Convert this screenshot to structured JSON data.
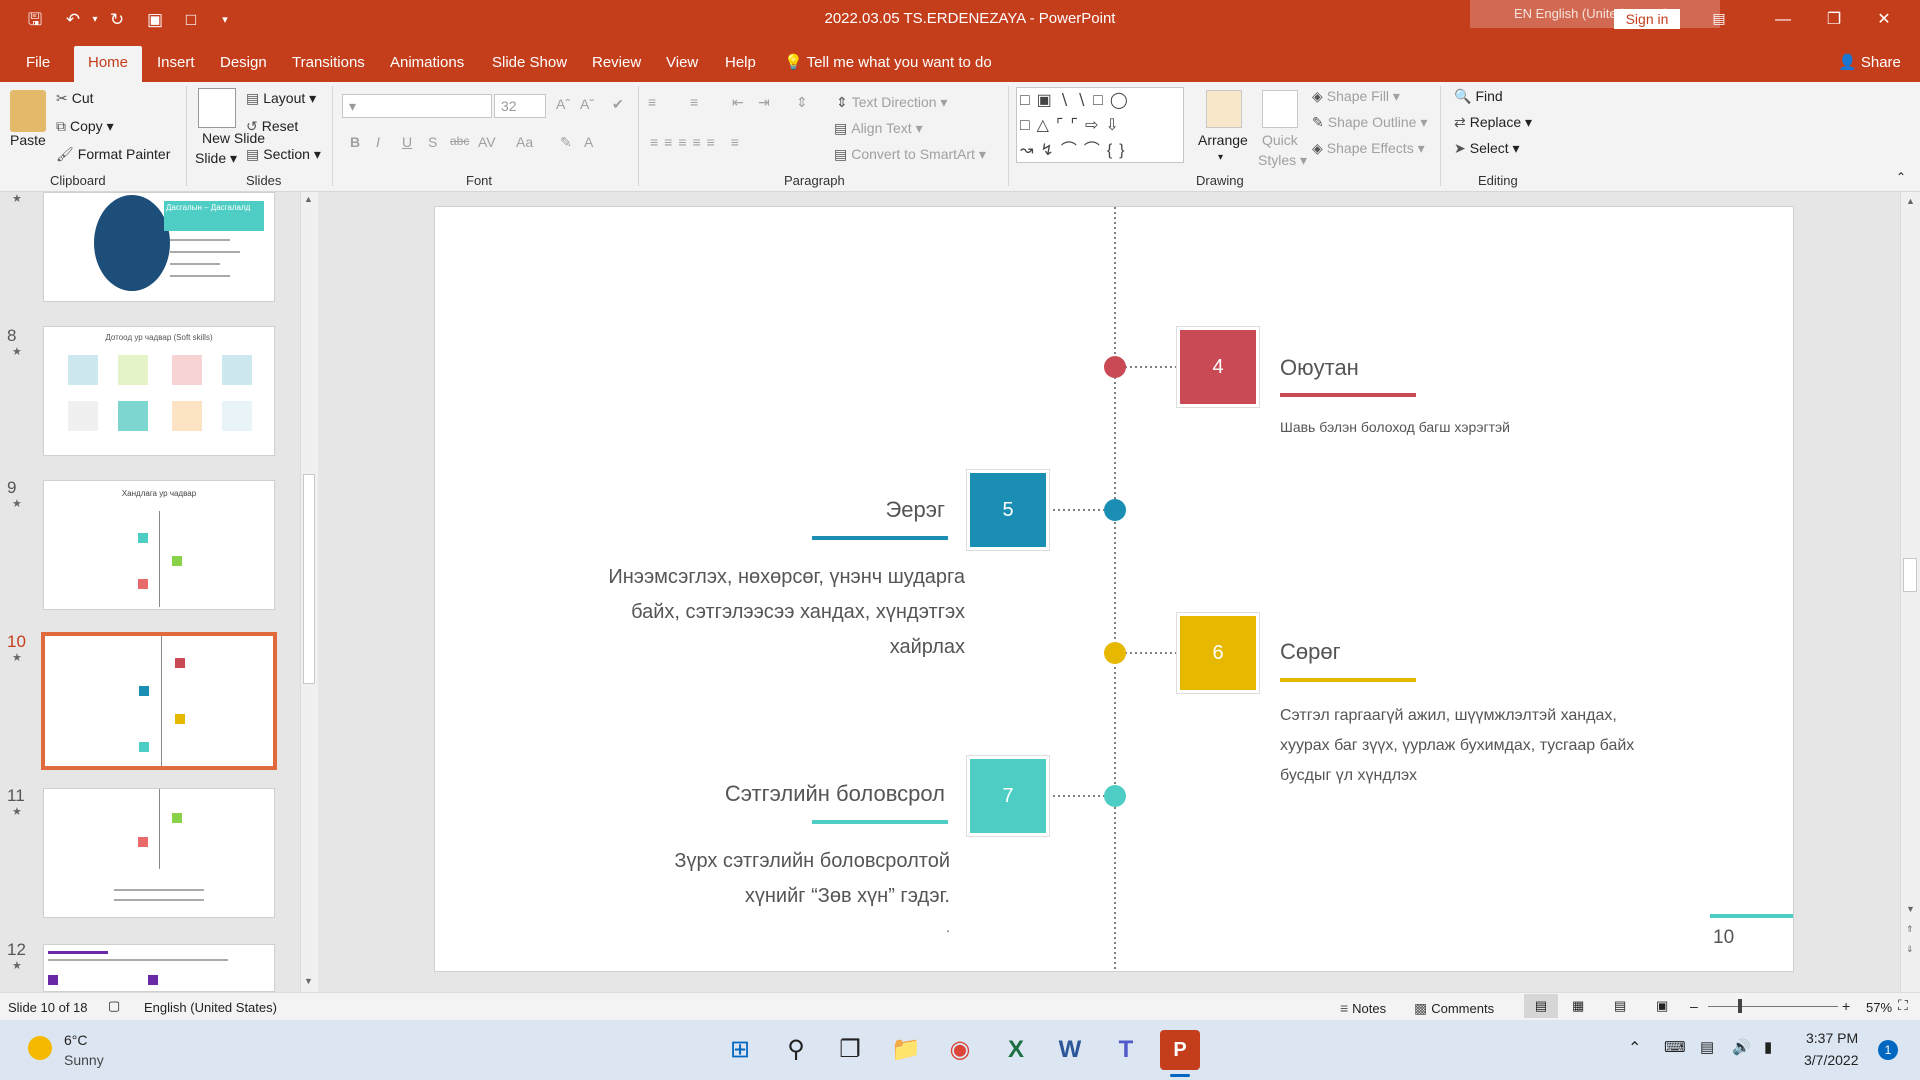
{
  "app": {
    "title": "2022.03.05 TS.ERDENEZAYA  -  PowerPoint",
    "language_indicator": "EN English (United States)",
    "sign_in": "Sign in",
    "accent_color": "#c43e1c"
  },
  "tabs": [
    "File",
    "Home",
    "Insert",
    "Design",
    "Transitions",
    "Animations",
    "Slide Show",
    "Review",
    "View",
    "Help"
  ],
  "tell_me": "Tell me what you want to do",
  "share": "Share",
  "ribbon": {
    "clipboard": {
      "label": "Clipboard",
      "paste": "Paste",
      "cut": "Cut",
      "copy": "Copy",
      "format_painter": "Format Painter"
    },
    "slides": {
      "label": "Slides",
      "new_slide": "New Slide",
      "new_slide_2": "Slide",
      "layout": "Layout",
      "reset": "Reset",
      "section": "Section"
    },
    "font": {
      "label": "Font",
      "size": "32",
      "buttons": [
        "B",
        "I",
        "U",
        "S",
        "abc",
        "AV",
        "Aa"
      ]
    },
    "paragraph": {
      "label": "Paragraph",
      "text_direction": "Text Direction",
      "align_text": "Align Text",
      "smartart": "Convert to SmartArt"
    },
    "drawing": {
      "label": "Drawing",
      "arrange": "Arrange",
      "quick_styles": "Quick",
      "quick_styles_2": "Styles",
      "shape_fill": "Shape Fill",
      "shape_outline": "Shape Outline",
      "shape_effects": "Shape Effects"
    },
    "editing": {
      "label": "Editing",
      "find": "Find",
      "replace": "Replace",
      "select": "Select"
    }
  },
  "thumbnails": [
    {
      "num": "",
      "title": "Дасгалын  – Дасгалалд"
    },
    {
      "num": "8",
      "title": "Дотоод ур чадвар (Soft skills)"
    },
    {
      "num": "9",
      "title": "Хандлага ур чадвар"
    },
    {
      "num": "10",
      "title": ""
    },
    {
      "num": "11",
      "title": ""
    },
    {
      "num": "12",
      "title": ""
    }
  ],
  "slide": {
    "items": [
      {
        "num": "4",
        "title": "Оюутан",
        "text": "Шавь бэлэн болоход багш хэрэгтэй",
        "color": "#c94a55"
      },
      {
        "num": "5",
        "title": "Эерэг",
        "text": [
          "Инээмсэглэх, нөхөрсөг, үнэнч шударга",
          "байх, сэтгэлээсээ хандах, хүндэтгэх",
          "хайрлах"
        ],
        "color": "#1a8fb3"
      },
      {
        "num": "6",
        "title": "Сөрөг",
        "text": [
          "Сэтгэл гаргаагүй ажил, шүүмжлэлтэй хандах,",
          "хуурах баг зүүх,  үурлаж бухимдах, тусгаар байх",
          "бусдыг үл хүндлэх"
        ],
        "color": "#e6b800"
      },
      {
        "num": "7",
        "title": "Сэтгэлийн боловсрол",
        "text": [
          "Зүрх сэтгэлийн боловсролтой",
          "хүнийг “Зөв хүн” гэдэг."
        ],
        "color": "#4ecdc4"
      }
    ],
    "page_number": "10",
    "dot_text": "."
  },
  "status": {
    "slide_of": "Slide 10 of 18",
    "language": "English (United States)",
    "notes": "Notes",
    "comments": "Comments",
    "zoom": "57%"
  },
  "taskbar": {
    "weather_temp": "6°C",
    "weather_desc": "Sunny",
    "time": "3:37 PM",
    "date": "3/7/2022",
    "notification_count": "1"
  }
}
